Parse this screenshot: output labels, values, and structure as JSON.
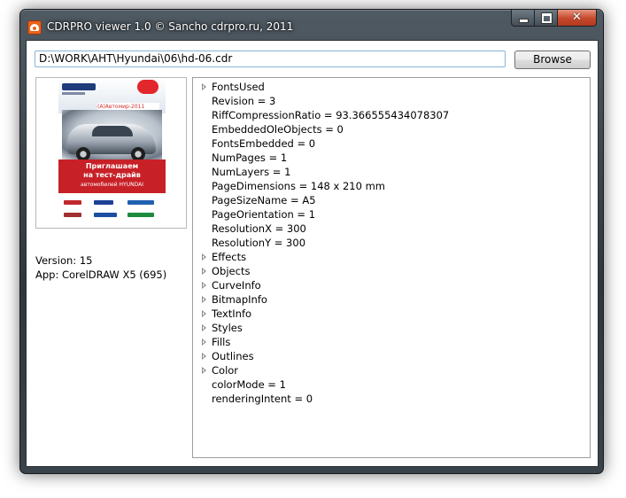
{
  "window": {
    "title": "CDRPRO viewer 1.0 © Sancho cdrpro.ru, 2011",
    "close_glyph": "✕"
  },
  "file_path": {
    "value": "D:\\WORK\\AHT\\Hyundai\\06\\hd-06.cdr"
  },
  "browse_button": {
    "label": "Browse"
  },
  "thumbnail": {
    "band_text": "(А)Автомир-2011",
    "headline_line1": "Приглашаем",
    "headline_line2": "на тест-драйв",
    "headline_line3": "автомобилей HYUNDAI"
  },
  "info": {
    "version": "Version: 15",
    "app": "App: CorelDRAW X5 (695)"
  },
  "tree": {
    "items": [
      {
        "label": "FontsUsed",
        "expandable": true
      },
      {
        "label": "Revision = 3",
        "expandable": false
      },
      {
        "label": "RiffCompressionRatio = 93.366555434078307",
        "expandable": false
      },
      {
        "label": "EmbeddedOleObjects = 0",
        "expandable": false
      },
      {
        "label": "FontsEmbedded = 0",
        "expandable": false
      },
      {
        "label": "NumPages = 1",
        "expandable": false
      },
      {
        "label": "NumLayers = 1",
        "expandable": false
      },
      {
        "label": "PageDimensions = 148 x 210 mm",
        "expandable": false
      },
      {
        "label": "PageSizeName = A5",
        "expandable": false
      },
      {
        "label": "PageOrientation = 1",
        "expandable": false
      },
      {
        "label": "ResolutionX = 300",
        "expandable": false
      },
      {
        "label": "ResolutionY = 300",
        "expandable": false
      },
      {
        "label": "Effects",
        "expandable": true
      },
      {
        "label": "Objects",
        "expandable": true
      },
      {
        "label": "CurveInfo",
        "expandable": true
      },
      {
        "label": "BitmapInfo",
        "expandable": true
      },
      {
        "label": "TextInfo",
        "expandable": true
      },
      {
        "label": "Styles",
        "expandable": true
      },
      {
        "label": "Fills",
        "expandable": true
      },
      {
        "label": "Outlines",
        "expandable": true
      },
      {
        "label": "Color",
        "expandable": true
      },
      {
        "label": "colorMode = 1",
        "expandable": false
      },
      {
        "label": "renderingIntent = 0",
        "expandable": false
      }
    ]
  },
  "colors": {
    "titlebar": "#3a434a",
    "close_button": "#c5482b",
    "input_border": "#88b4d8",
    "thumbnail_red": "#c72127"
  }
}
